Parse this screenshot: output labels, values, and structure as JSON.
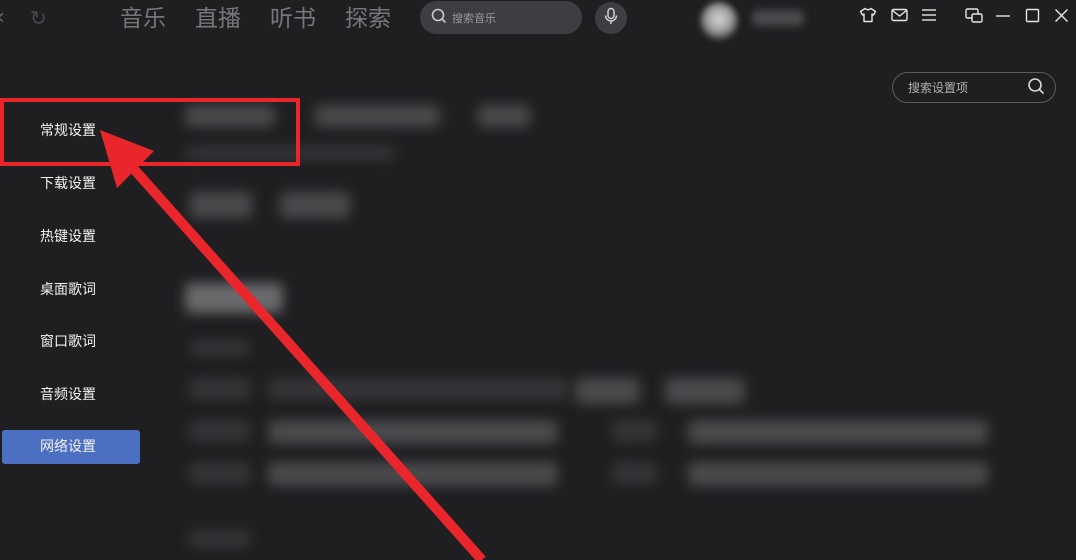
{
  "topbar": {
    "tabs": [
      "音乐",
      "直播",
      "听书",
      "探索"
    ],
    "search_placeholder": "搜索音乐",
    "icons": [
      "back-icon",
      "refresh-icon",
      "search-icon",
      "microphone-icon",
      "skin-icon",
      "mail-icon",
      "menu-icon",
      "mini-mode-icon",
      "minimize-icon",
      "maximize-icon",
      "close-icon"
    ]
  },
  "sidebar": {
    "items": [
      {
        "label": "常规设置",
        "active": false
      },
      {
        "label": "下载设置",
        "active": false
      },
      {
        "label": "热键设置",
        "active": false
      },
      {
        "label": "桌面歌词",
        "active": false
      },
      {
        "label": "窗口歌词",
        "active": false
      },
      {
        "label": "音频设置",
        "active": false
      },
      {
        "label": "网络设置",
        "active": true
      }
    ]
  },
  "settings_search": {
    "placeholder": "搜索设置项"
  },
  "colors": {
    "background": "#1f1f22",
    "active_item": "#4b6fc1",
    "annotation_red": "#e8262b"
  }
}
